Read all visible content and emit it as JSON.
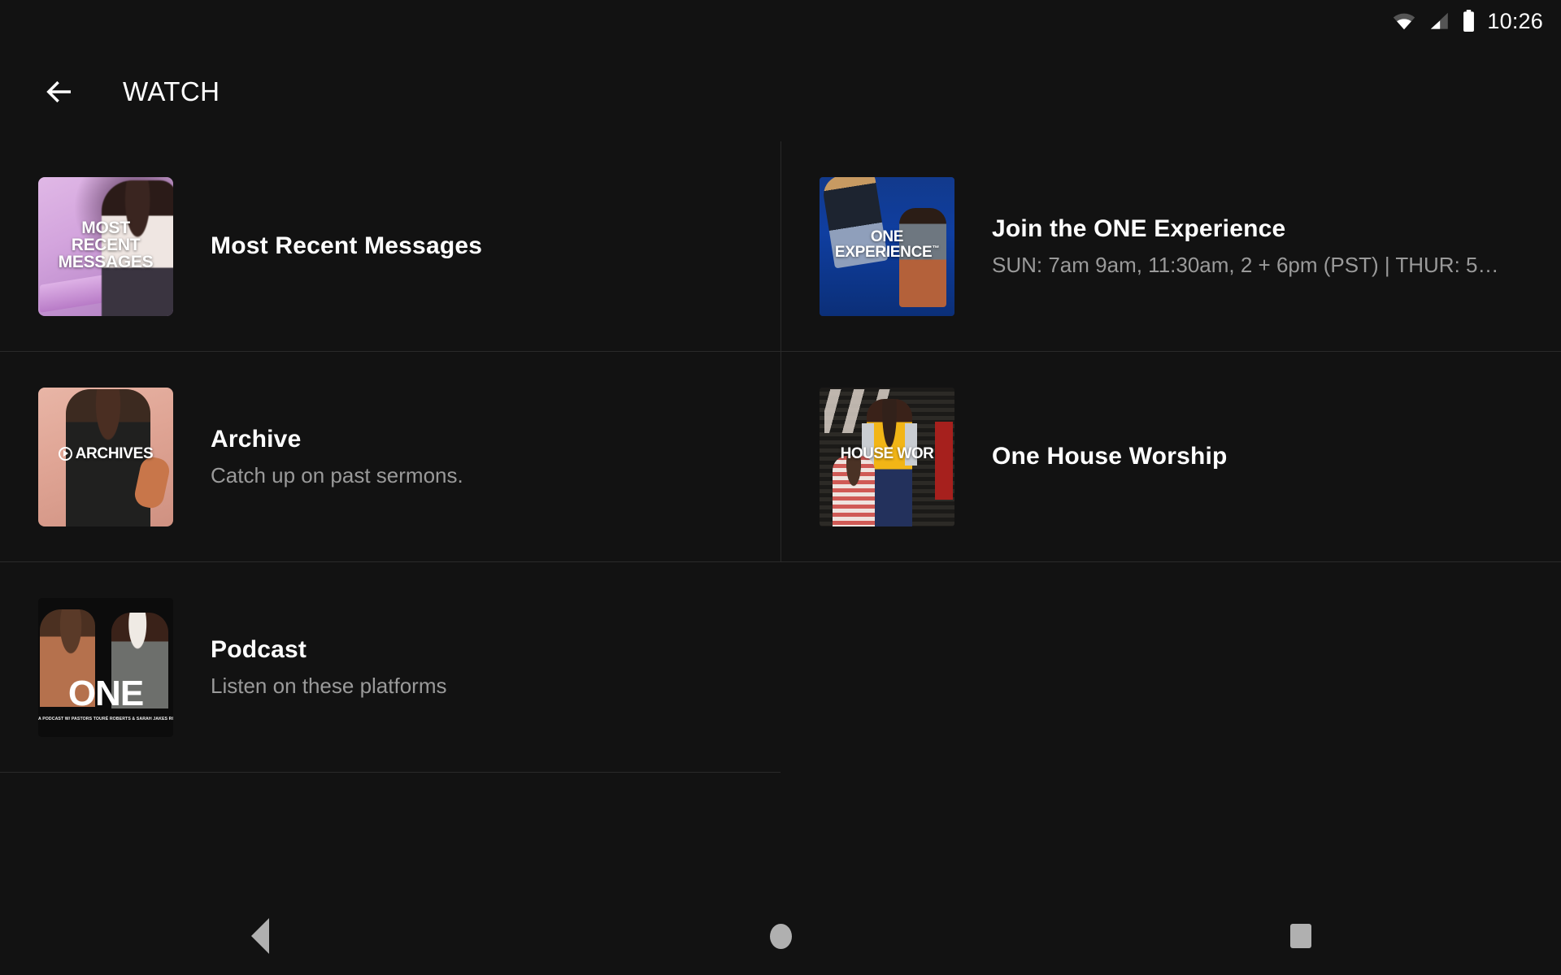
{
  "status_bar": {
    "icons": [
      "wifi-icon",
      "cellular-signal-icon",
      "battery-icon"
    ],
    "time": "10:26"
  },
  "app_bar": {
    "back_icon": "back-arrow-icon",
    "title": "WATCH"
  },
  "colors": {
    "background": "#121212",
    "divider": "#2a2a2a",
    "title_text": "#ffffff",
    "subtitle_text": "#9a9a9a",
    "nav_icon": "#b0b0b0"
  },
  "items": [
    {
      "title": "Most Recent Messages",
      "subtitle": "",
      "thumbnail_label": "MOST\nRECENT\nMESSAGES",
      "thumbnail_line1": "MOST",
      "thumbnail_line2": "RECENT",
      "thumbnail_line3": "MESSAGES"
    },
    {
      "title": "Join the ONE Experience",
      "subtitle": "SUN: 7am 9am, 11:30am, 2 + 6pm (PST) | THUR: 5…",
      "thumbnail_line1": "ONE",
      "thumbnail_line2": "EXPERIENCE",
      "thumbnail_tm": "™"
    },
    {
      "title": "Archive",
      "subtitle": "Catch up on past sermons.",
      "thumbnail_line1": "ARCHIVES"
    },
    {
      "title": "One House Worship",
      "subtitle": "",
      "thumbnail_line1": "HOUSE WOR"
    },
    {
      "title": "Podcast",
      "subtitle": "Listen on these platforms",
      "thumbnail_line1": "ONE",
      "thumbnail_caption": "A PODCAST W/ PASTORS TOURÉ ROBERTS & SARAH JAKES ROBERTS"
    }
  ],
  "nav_bar": {
    "back_label": "back-navigation-button",
    "home_label": "home-navigation-button",
    "recents_label": "recents-navigation-button"
  }
}
